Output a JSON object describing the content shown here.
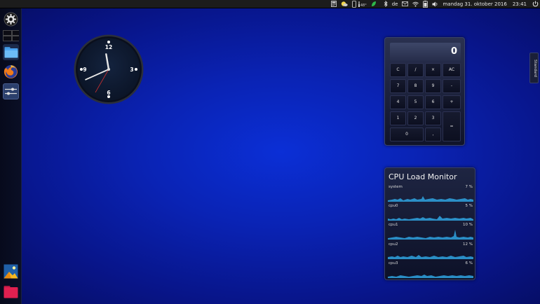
{
  "top_panel": {
    "temperature": "48°",
    "keyboard_layout": "de",
    "datetime": "mandag 31. oktober 2016",
    "time": "23:41",
    "tray_icons": [
      "calculator-icon",
      "weather-icon",
      "phone-icon",
      "leaf-icon",
      "bluetooth-icon",
      "keyboard-layout",
      "mail-icon",
      "network-wifi-icon",
      "battery-icon",
      "volume-icon",
      "power-icon"
    ]
  },
  "launcher": {
    "items": [
      {
        "name": "settings-icon",
        "color": "#dddddd"
      },
      {
        "name": "workspaces-icon",
        "color": "#888888"
      },
      {
        "name": "files-icon",
        "color": "#4aa3f0"
      },
      {
        "name": "firefox-icon",
        "color": "#f27b19"
      },
      {
        "name": "switcher-icon",
        "color": "#3a5a90"
      },
      {
        "name": "image-viewer-icon",
        "color": "#f5b820"
      },
      {
        "name": "folder-red-icon",
        "color": "#e02050"
      }
    ]
  },
  "clock": {
    "labels": {
      "twelve": "12",
      "three": "3",
      "six": "6",
      "nine": "9"
    },
    "hour_hand_hours": 11.68,
    "minute_hand_minutes": 41,
    "second_hand_seconds": 35
  },
  "calculator": {
    "display": "0",
    "buttons": {
      "c": "C",
      "divide": "/",
      "multiply": "×",
      "ac": "AC",
      "n7": "7",
      "n8": "8",
      "n9": "9",
      "minus": "-",
      "n4": "4",
      "n5": "5",
      "n6": "6",
      "plus": "+",
      "n1": "1",
      "n2": "2",
      "n3": "3",
      "equals": "=",
      "n0": "0",
      "decimal": ","
    }
  },
  "cpu_monitor": {
    "title": "CPU Load Monitor",
    "accent_color": "#2fa3e0",
    "rows": [
      {
        "label": "system",
        "value": "7 %"
      },
      {
        "label": "cpu0",
        "value": "5 %"
      },
      {
        "label": "cpu1",
        "value": "10 %"
      },
      {
        "label": "cpu2",
        "value": "12 %"
      },
      {
        "label": "cpu3",
        "value": "6 %"
      }
    ]
  },
  "side_tab": {
    "label": "Standard"
  }
}
